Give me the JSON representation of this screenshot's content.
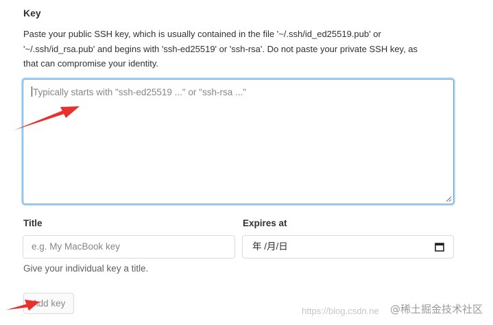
{
  "key_section": {
    "label": "Key",
    "help_line1": "Paste your public SSH key, which is usually contained in the file '~/.ssh/id_ed25519.pub' or",
    "help_line2": "'~/.ssh/id_rsa.pub' and begins with 'ssh-ed25519' or 'ssh-rsa'. Do not paste your private SSH key, as",
    "help_line3": "that can compromise your identity.",
    "textarea_value": "",
    "textarea_placeholder": "Typically starts with \"ssh-ed25519 ...\" or \"ssh-rsa ...\""
  },
  "title_field": {
    "label": "Title",
    "value": "",
    "placeholder": "e.g. My MacBook key",
    "help": "Give your individual key a title."
  },
  "expires_field": {
    "label": "Expires at",
    "value": "年 /月/日",
    "icon": "calendar-icon"
  },
  "add_key_button": {
    "label": "Add key"
  },
  "annotations": {
    "arrow_color": "#e8302c"
  },
  "watermark": {
    "url": "https://blog.csdn.ne",
    "brand": "@稀土掘金技术社区"
  },
  "colors": {
    "focus_border": "#5aa5dc",
    "input_border": "#dbdbdb",
    "text": "#303030"
  }
}
